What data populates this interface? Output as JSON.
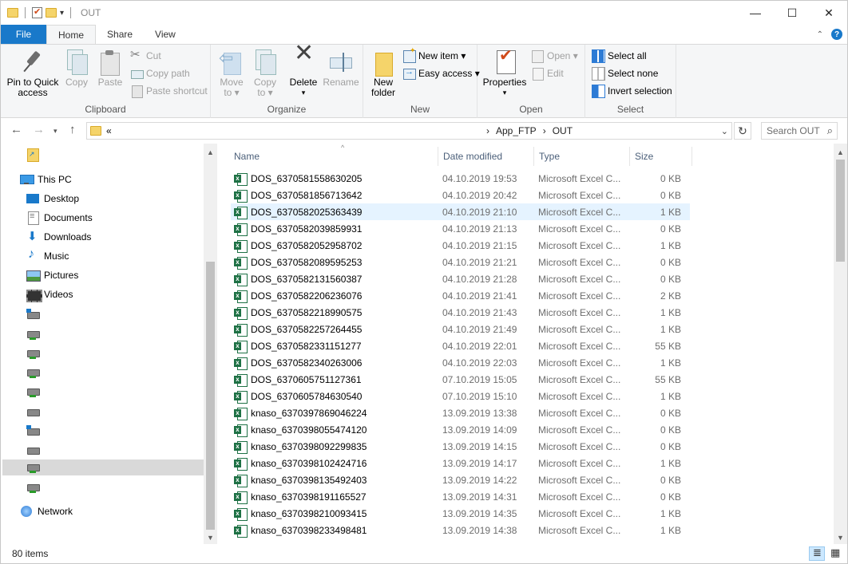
{
  "window": {
    "title": "OUT",
    "controls": [
      "—",
      "☐",
      "✕"
    ]
  },
  "tabs": {
    "file": "File",
    "home": "Home",
    "share": "Share",
    "view": "View"
  },
  "ribbon": {
    "clipboard": {
      "label": "Clipboard",
      "pin": [
        "Pin to Quick",
        "access"
      ],
      "copy": "Copy",
      "paste": "Paste",
      "cut": "Cut",
      "copy_path": "Copy path",
      "paste_shortcut": "Paste shortcut"
    },
    "organize": {
      "label": "Organize",
      "move_to": [
        "Move",
        "to ▾"
      ],
      "copy_to": [
        "Copy",
        "to ▾"
      ],
      "delete": [
        "Delete",
        "▾"
      ],
      "rename": "Rename"
    },
    "new": {
      "label": "New",
      "new_folder": [
        "New",
        "folder"
      ],
      "new_item": "New item ▾",
      "easy_access": "Easy access ▾"
    },
    "open": {
      "label": "Open",
      "properties": [
        "Properties",
        "▾"
      ],
      "open": "Open ▾",
      "edit": "Edit"
    },
    "select": {
      "label": "Select",
      "select_all": "Select all",
      "select_none": "Select none",
      "invert_selection": "Invert selection"
    }
  },
  "address": {
    "overflow": "«",
    "crumbs": [
      "App_FTP",
      "›",
      "OUT"
    ],
    "sep": "›",
    "search_placeholder": "Search OUT"
  },
  "nav": {
    "this_pc": "This PC",
    "desktop": "Desktop",
    "documents": "Documents",
    "downloads": "Downloads",
    "music": "Music",
    "pictures": "Pictures",
    "videos": "Videos",
    "network": "Network"
  },
  "columns": {
    "name": "Name",
    "date": "Date modified",
    "type": "Type",
    "size": "Size",
    "sort_indicator": "^"
  },
  "files": [
    {
      "name": "DOS_6370581558630205",
      "date": "04.10.2019 19:53",
      "type": "Microsoft Excel C...",
      "size": "0 KB"
    },
    {
      "name": "DOS_6370581856713642",
      "date": "04.10.2019 20:42",
      "type": "Microsoft Excel C...",
      "size": "0 KB"
    },
    {
      "name": "DOS_6370582025363439",
      "date": "04.10.2019 21:10",
      "type": "Microsoft Excel C...",
      "size": "1 KB"
    },
    {
      "name": "DOS_6370582039859931",
      "date": "04.10.2019 21:13",
      "type": "Microsoft Excel C...",
      "size": "0 KB"
    },
    {
      "name": "DOS_6370582052958702",
      "date": "04.10.2019 21:15",
      "type": "Microsoft Excel C...",
      "size": "1 KB"
    },
    {
      "name": "DOS_6370582089595253",
      "date": "04.10.2019 21:21",
      "type": "Microsoft Excel C...",
      "size": "0 KB"
    },
    {
      "name": "DOS_6370582131560387",
      "date": "04.10.2019 21:28",
      "type": "Microsoft Excel C...",
      "size": "0 KB"
    },
    {
      "name": "DOS_6370582206236076",
      "date": "04.10.2019 21:41",
      "type": "Microsoft Excel C...",
      "size": "2 KB"
    },
    {
      "name": "DOS_6370582218990575",
      "date": "04.10.2019 21:43",
      "type": "Microsoft Excel C...",
      "size": "1 KB"
    },
    {
      "name": "DOS_6370582257264455",
      "date": "04.10.2019 21:49",
      "type": "Microsoft Excel C...",
      "size": "1 KB"
    },
    {
      "name": "DOS_6370582331151277",
      "date": "04.10.2019 22:01",
      "type": "Microsoft Excel C...",
      "size": "55 KB"
    },
    {
      "name": "DOS_6370582340263006",
      "date": "04.10.2019 22:03",
      "type": "Microsoft Excel C...",
      "size": "1 KB"
    },
    {
      "name": "DOS_6370605751127361",
      "date": "07.10.2019 15:05",
      "type": "Microsoft Excel C...",
      "size": "55 KB"
    },
    {
      "name": "DOS_6370605784630540",
      "date": "07.10.2019 15:10",
      "type": "Microsoft Excel C...",
      "size": "1 KB"
    },
    {
      "name": "knaso_6370397869046224",
      "date": "13.09.2019 13:38",
      "type": "Microsoft Excel C...",
      "size": "0 KB"
    },
    {
      "name": "knaso_6370398055474120",
      "date": "13.09.2019 14:09",
      "type": "Microsoft Excel C...",
      "size": "0 KB"
    },
    {
      "name": "knaso_6370398092299835",
      "date": "13.09.2019 14:15",
      "type": "Microsoft Excel C...",
      "size": "0 KB"
    },
    {
      "name": "knaso_6370398102424716",
      "date": "13.09.2019 14:17",
      "type": "Microsoft Excel C...",
      "size": "1 KB"
    },
    {
      "name": "knaso_6370398135492403",
      "date": "13.09.2019 14:22",
      "type": "Microsoft Excel C...",
      "size": "0 KB"
    },
    {
      "name": "knaso_6370398191165527",
      "date": "13.09.2019 14:31",
      "type": "Microsoft Excel C...",
      "size": "0 KB"
    },
    {
      "name": "knaso_6370398210093415",
      "date": "13.09.2019 14:35",
      "type": "Microsoft Excel C...",
      "size": "1 KB"
    },
    {
      "name": "knaso_6370398233498481",
      "date": "13.09.2019 14:38",
      "type": "Microsoft Excel C...",
      "size": "1 KB"
    }
  ],
  "status": {
    "item_count": "80 items"
  }
}
